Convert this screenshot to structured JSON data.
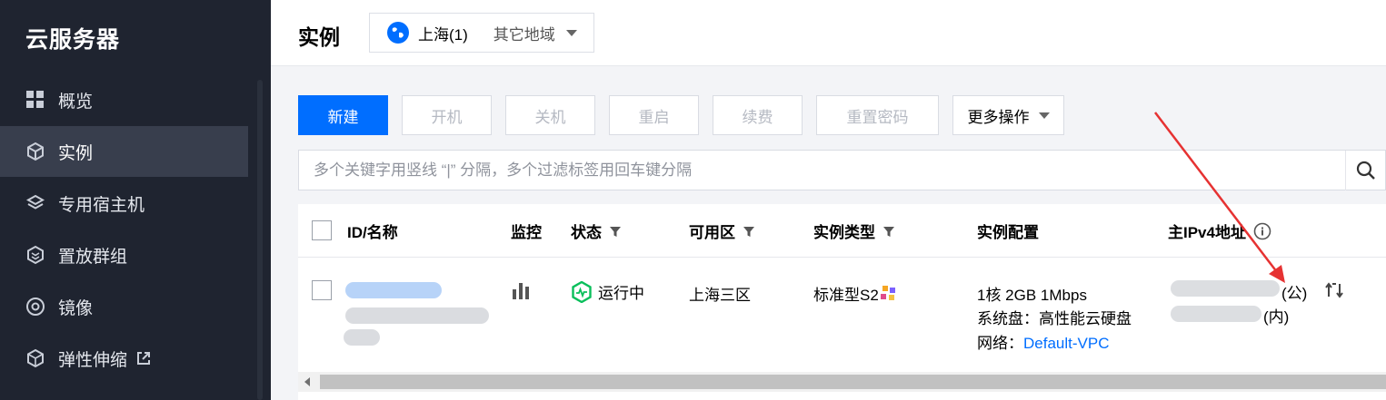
{
  "sidebar": {
    "brand": "云服务器",
    "items": [
      {
        "label": "概览",
        "icon": "grid-icon"
      },
      {
        "label": "实例",
        "icon": "cube-icon"
      },
      {
        "label": "专用宿主机",
        "icon": "layers-icon"
      },
      {
        "label": "置放群组",
        "icon": "group-icon"
      },
      {
        "label": "镜像",
        "icon": "disc-icon"
      },
      {
        "label": "弹性伸缩",
        "icon": "scale-icon"
      }
    ],
    "active_index": 1
  },
  "header": {
    "title": "实例",
    "region": {
      "current": "上海(1)",
      "other": "其它地域",
      "icon": "globe-icon"
    }
  },
  "toolbar": {
    "create": "新建",
    "start": "开机",
    "stop": "关机",
    "restart": "重启",
    "renew": "续费",
    "reset_password": "重置密码",
    "more": "更多操作"
  },
  "search": {
    "placeholder": "多个关键字用竖线 “|” 分隔，多个过滤标签用回车键分隔"
  },
  "table": {
    "columns": {
      "id_name": "ID/名称",
      "monitor": "监控",
      "status": "状态",
      "zone": "可用区",
      "type": "实例类型",
      "config": "实例配置",
      "ipv4": "主IPv4地址"
    },
    "rows": [
      {
        "status": "运行中",
        "zone": "上海三区",
        "type": "标准型S2",
        "config_line1": "1核 2GB 1Mbps",
        "config_line2": "系统盘：高性能云硬盘",
        "network_label": "网络：",
        "network_link": "Default-VPC",
        "ip_public_suffix": "(公)",
        "ip_private_suffix": "(内)"
      }
    ]
  },
  "colors": {
    "primary": "#006eff",
    "sidebar_bg": "#1f2430",
    "status_running": "#0abf5b",
    "annotation_arrow": "#e63232"
  }
}
